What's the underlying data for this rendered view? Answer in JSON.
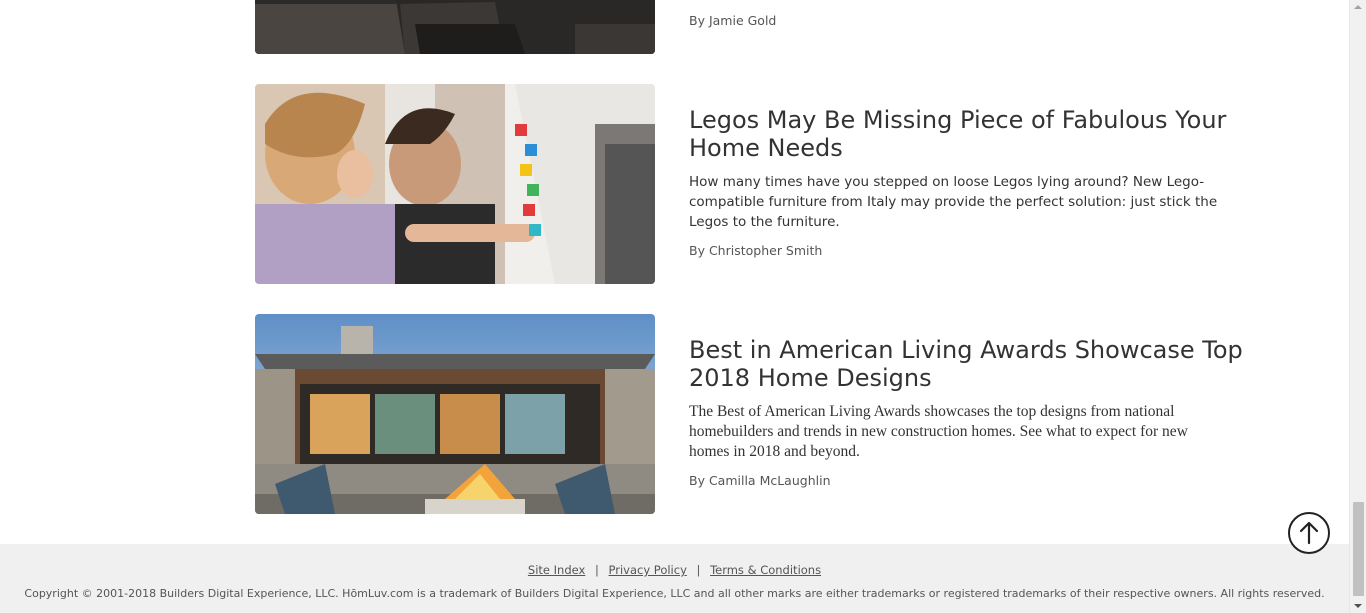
{
  "articles": [
    {
      "author": "By Jamie Gold",
      "image_alt": "kitchen-counter-photo"
    },
    {
      "title": "Legos May Be Missing Piece of Fabulous Your Home Needs",
      "description": "How many times have you stepped on loose Legos lying around? New Lego-compatible furniture from Italy may provide the perfect solution: just stick the Legos to the furniture.",
      "author": "By Christopher Smith",
      "image_alt": "child-and-man-building-legos-photo"
    },
    {
      "title": "Best in American Living Awards Showcase Top 2018 Home Designs",
      "description": "The Best of American Living Awards showcases the top designs from national homebuilders and trends in new construction homes. See what to expect for new homes in 2018 and beyond.",
      "author": "By Camilla McLaughlin",
      "image_alt": "modern-house-patio-firepit-photo"
    }
  ],
  "footer": {
    "links": [
      "Site Index",
      "Privacy Policy",
      "Terms & Conditions"
    ],
    "separator": "|",
    "copyright": "Copyright © 2001-2018 Builders Digital Experience, LLC. HōmLuv.com is a trademark of Builders Digital Experience, LLC and all other marks are either trademarks or registered trademarks of their respective owners. All rights reserved."
  },
  "back_to_top": {
    "icon": "arrow-up-circle-icon"
  }
}
